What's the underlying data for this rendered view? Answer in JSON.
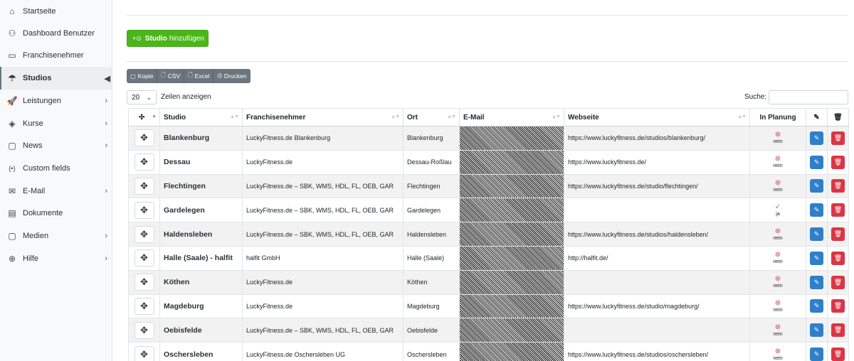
{
  "sidebar": {
    "items": [
      {
        "label": "Startseite",
        "icon": "⌂",
        "icon_name": "home-icon",
        "chevron": false,
        "active": false
      },
      {
        "label": "Dashboard Benutzer",
        "icon": "⚇",
        "icon_name": "users-icon",
        "chevron": false,
        "active": false
      },
      {
        "label": "Franchisenehmer",
        "icon": "▭",
        "icon_name": "briefcase-icon",
        "chevron": false,
        "active": false
      },
      {
        "label": "Studios",
        "icon": "☂",
        "icon_name": "umbrella-icon",
        "chevron": true,
        "chevron_glyph": "◀",
        "active": true
      },
      {
        "label": "Leistungen",
        "icon": "🚀",
        "icon_name": "rocket-icon",
        "chevron": true,
        "chevron_glyph": "›",
        "active": false
      },
      {
        "label": "Kurse",
        "icon": "◈",
        "icon_name": "layers-icon",
        "chevron": true,
        "chevron_glyph": "›",
        "active": false
      },
      {
        "label": "News",
        "icon": "▢",
        "icon_name": "copy-icon",
        "chevron": true,
        "chevron_glyph": "›",
        "active": false
      },
      {
        "label": "Custom fields",
        "icon": "{•}",
        "icon_name": "braces-icon",
        "chevron": false,
        "active": false
      },
      {
        "label": "E-Mail",
        "icon": "✉",
        "icon_name": "mail-icon",
        "chevron": true,
        "chevron_glyph": "›",
        "active": false
      },
      {
        "label": "Dokumente",
        "icon": "▤",
        "icon_name": "document-icon",
        "chevron": false,
        "active": false
      },
      {
        "label": "Medien",
        "icon": "▢",
        "icon_name": "media-icon",
        "chevron": true,
        "chevron_glyph": "›",
        "active": false
      },
      {
        "label": "Hilfe",
        "icon": "⊕",
        "icon_name": "lifebuoy-icon",
        "chevron": true,
        "chevron_glyph": "›",
        "active": false
      }
    ]
  },
  "add_button": {
    "icon": "+⊙",
    "bold": "Studio",
    "rest": "hinzufügen"
  },
  "export_buttons": [
    {
      "icon": "▢",
      "icon_name": "copy-icon",
      "label": "Kopie"
    },
    {
      "icon": "🗋",
      "icon_name": "file-csv-icon",
      "label": "CSV"
    },
    {
      "icon": "🗋",
      "icon_name": "file-excel-icon",
      "label": "Excel"
    },
    {
      "icon": "⎙",
      "icon_name": "printer-icon",
      "label": "Drucken"
    }
  ],
  "length": {
    "value": "20",
    "chevron": "⌄",
    "label": "Zeilen anzeigen"
  },
  "search": {
    "label": "Suche:"
  },
  "table": {
    "headers": {
      "move": "✣",
      "studio": "Studio",
      "franchise": "Franchisenehmer",
      "ort": "Ort",
      "email": "E-Mail",
      "website": "Webseite",
      "planning": "In Planung",
      "edit_icon": "✎",
      "delete_icon": "🗑",
      "sort_glyph": "▲▼",
      "sort_up": "▲"
    },
    "move_glyph": "✥",
    "edit_glyph": "✎",
    "delete_glyph": "🗑",
    "rows": [
      {
        "studio": "Blankenburg",
        "franchise": "LuckyFitness.de Blankenburg",
        "ort": "Blankenburg",
        "website": "https://www.luckyfitness.de/studios/blankenburg/",
        "planning": "nein",
        "planning_icon": "⊗"
      },
      {
        "studio": "Dessau",
        "franchise": "LuckyFitness.de",
        "ort": "Dessau-Roßlau",
        "website": "https://www.luckyfitness.de/",
        "planning": "nein",
        "planning_icon": "⊗"
      },
      {
        "studio": "Flechtingen",
        "franchise": "LuckyFitness.de – SBK, WMS, HDL, FL, OEB, GAR",
        "ort": "Flechtingen",
        "website": "https://www.luckyfitness.de/studio/flechtingen/",
        "planning": "nein",
        "planning_icon": "⊗"
      },
      {
        "studio": "Gardelegen",
        "franchise": "LuckyFitness.de – SBK, WMS, HDL, FL, OEB, GAR",
        "ort": "Gardelegen",
        "website": "",
        "planning": "ja",
        "planning_icon": "✓"
      },
      {
        "studio": "Haldensleben",
        "franchise": "LuckyFitness.de – SBK, WMS, HDL, FL, OEB, GAR",
        "ort": "Haldensleben",
        "website": "https://www.luckyfitness.de/studios/haldensleben/",
        "planning": "nein",
        "planning_icon": "⊗"
      },
      {
        "studio": "Halle (Saale) - halfit",
        "franchise": "halfit GmbH",
        "ort": "Halle (Saale)",
        "website": "http://halfit.de/",
        "planning": "nein",
        "planning_icon": "⊗"
      },
      {
        "studio": "Köthen",
        "franchise": "LuckyFitness.de",
        "ort": "Köthen",
        "website": "",
        "planning": "nein",
        "planning_icon": "⊗"
      },
      {
        "studio": "Magdeburg",
        "franchise": "LuckyFitness.de",
        "ort": "Magdeburg",
        "website": "https://www.luckyfitness.de/studio/magdeburg/",
        "planning": "nein",
        "planning_icon": "⊗"
      },
      {
        "studio": "Oebisfelde",
        "franchise": "LuckyFitness.de – SBK, WMS, HDL, FL, OEB, GAR",
        "ort": "Oebisfelde",
        "website": "",
        "planning": "nein",
        "planning_icon": "⊗"
      },
      {
        "studio": "Oschersleben",
        "franchise": "LuckyFitness.de Oschersleben UG",
        "ort": "Oschersleben",
        "website": "https://www.luckyfitness.de/studios/oschersleben/",
        "planning": "nein",
        "planning_icon": "⊗"
      }
    ]
  }
}
